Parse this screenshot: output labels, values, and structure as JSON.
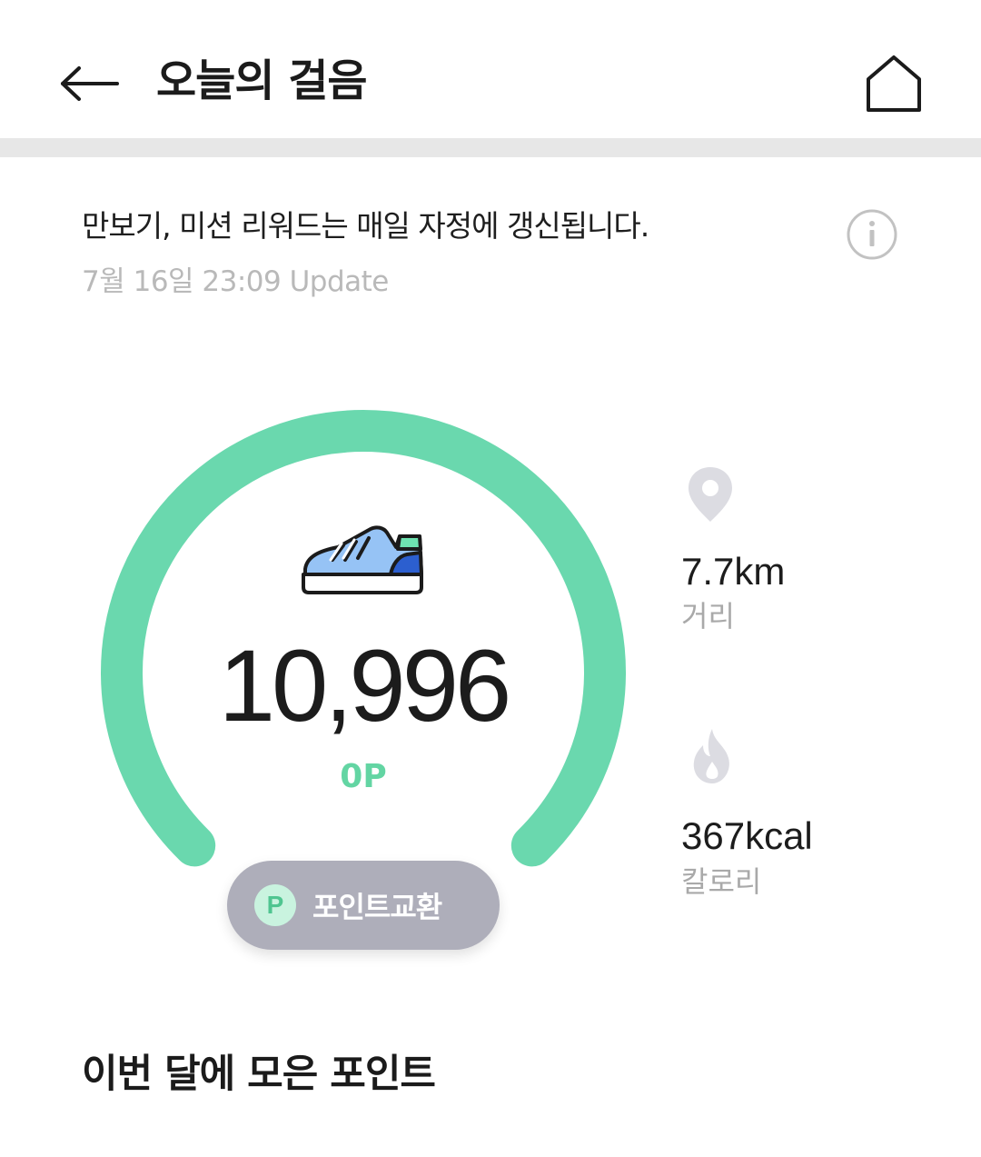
{
  "header": {
    "title": "오늘의 걸음",
    "back_icon": "arrow-left-icon",
    "home_icon": "home-icon"
  },
  "notice": {
    "text": "만보기, 미션 리워드는 매일 자정에 갱신됩니다.",
    "update_time": "7월 16일 23:09 Update",
    "info_icon": "info-icon"
  },
  "summary": {
    "steps": "10,996",
    "points": "0P",
    "shoe_icon": "sneaker-icon",
    "gauge_progress": 1.0,
    "exchange_button": {
      "badge": "P",
      "label": "포인트교환"
    }
  },
  "stats": [
    {
      "icon": "location-pin-icon",
      "value": "7.7km",
      "label": "거리"
    },
    {
      "icon": "flame-icon",
      "value": "367kcal",
      "label": "칼로리"
    }
  ],
  "section": {
    "title": "이번 달에 모은 포인트"
  },
  "colors": {
    "accent": "#63d5a3",
    "gauge": "#6ad8ae",
    "button_bg": "#aeaeba",
    "muted_text": "#b9b9b9",
    "icon_gray": "#dcdce2"
  }
}
